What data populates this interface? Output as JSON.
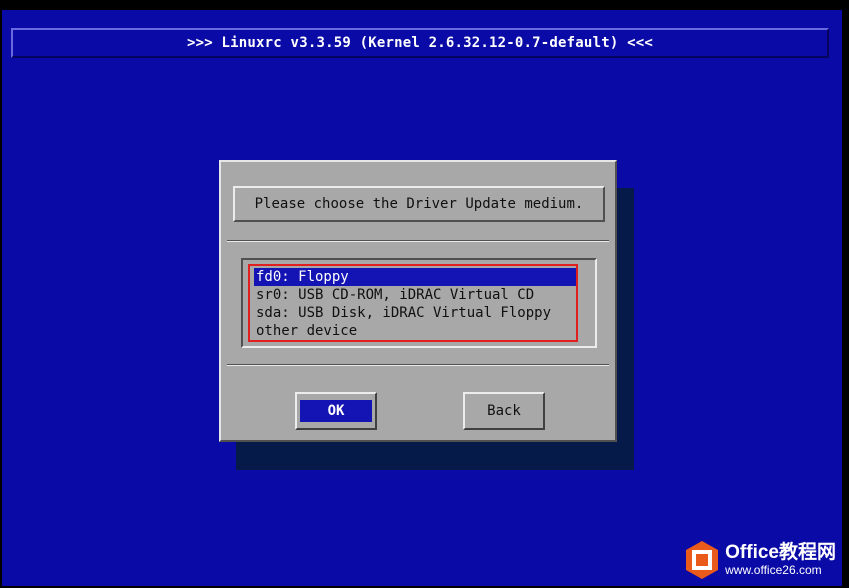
{
  "header": {
    "title": ">>> Linuxrc v3.3.59 (Kernel 2.6.32.12-0.7-default) <<<"
  },
  "dialog": {
    "prompt": "Please choose the Driver Update medium.",
    "options": [
      {
        "label": "fd0: Floppy",
        "selected": true
      },
      {
        "label": "sr0: USB CD-ROM, iDRAC Virtual CD",
        "selected": false
      },
      {
        "label": "sda: USB Disk, iDRAC Virtual Floppy",
        "selected": false
      },
      {
        "label": "other device",
        "selected": false
      }
    ],
    "buttons": {
      "ok_label": "OK",
      "back_label": "Back"
    }
  },
  "watermark": {
    "name": "Office教程网",
    "url": "www.office26.com",
    "icon": "office-logo-icon"
  },
  "colors": {
    "screen_bg": "#0a0aa6",
    "dialog_bg": "#a8a8a8",
    "selection": "#1414b4",
    "highlight_border": "#e02020",
    "watermark_logo": "#ea5a1a"
  }
}
